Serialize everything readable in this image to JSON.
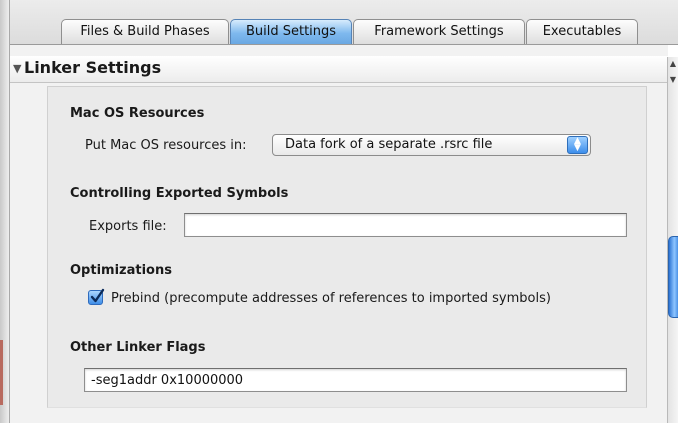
{
  "tabs": [
    {
      "label": "Files & Build Phases",
      "active": false
    },
    {
      "label": "Build Settings",
      "active": true
    },
    {
      "label": "Framework Settings",
      "active": false
    },
    {
      "label": "Executables",
      "active": false
    }
  ],
  "section": {
    "title": "Linker Settings",
    "disclosure_icon": "triangle-down"
  },
  "groups": {
    "mac_os_resources": {
      "title": "Mac OS Resources",
      "put_label": "Put Mac OS resources in:",
      "put_value": "Data fork of a separate .rsrc file"
    },
    "exported_symbols": {
      "title": "Controlling Exported Symbols",
      "exports_label": "Exports file:",
      "exports_value": ""
    },
    "optimizations": {
      "title": "Optimizations",
      "prebind_label": "Prebind (precompute addresses of references to imported symbols)",
      "prebind_checked": true
    },
    "other_linker_flags": {
      "title": "Other Linker Flags",
      "value": "-seg1addr 0x10000000"
    }
  },
  "colors": {
    "active_tab": "#7fb9ee",
    "accent": "#3f8ee8"
  }
}
